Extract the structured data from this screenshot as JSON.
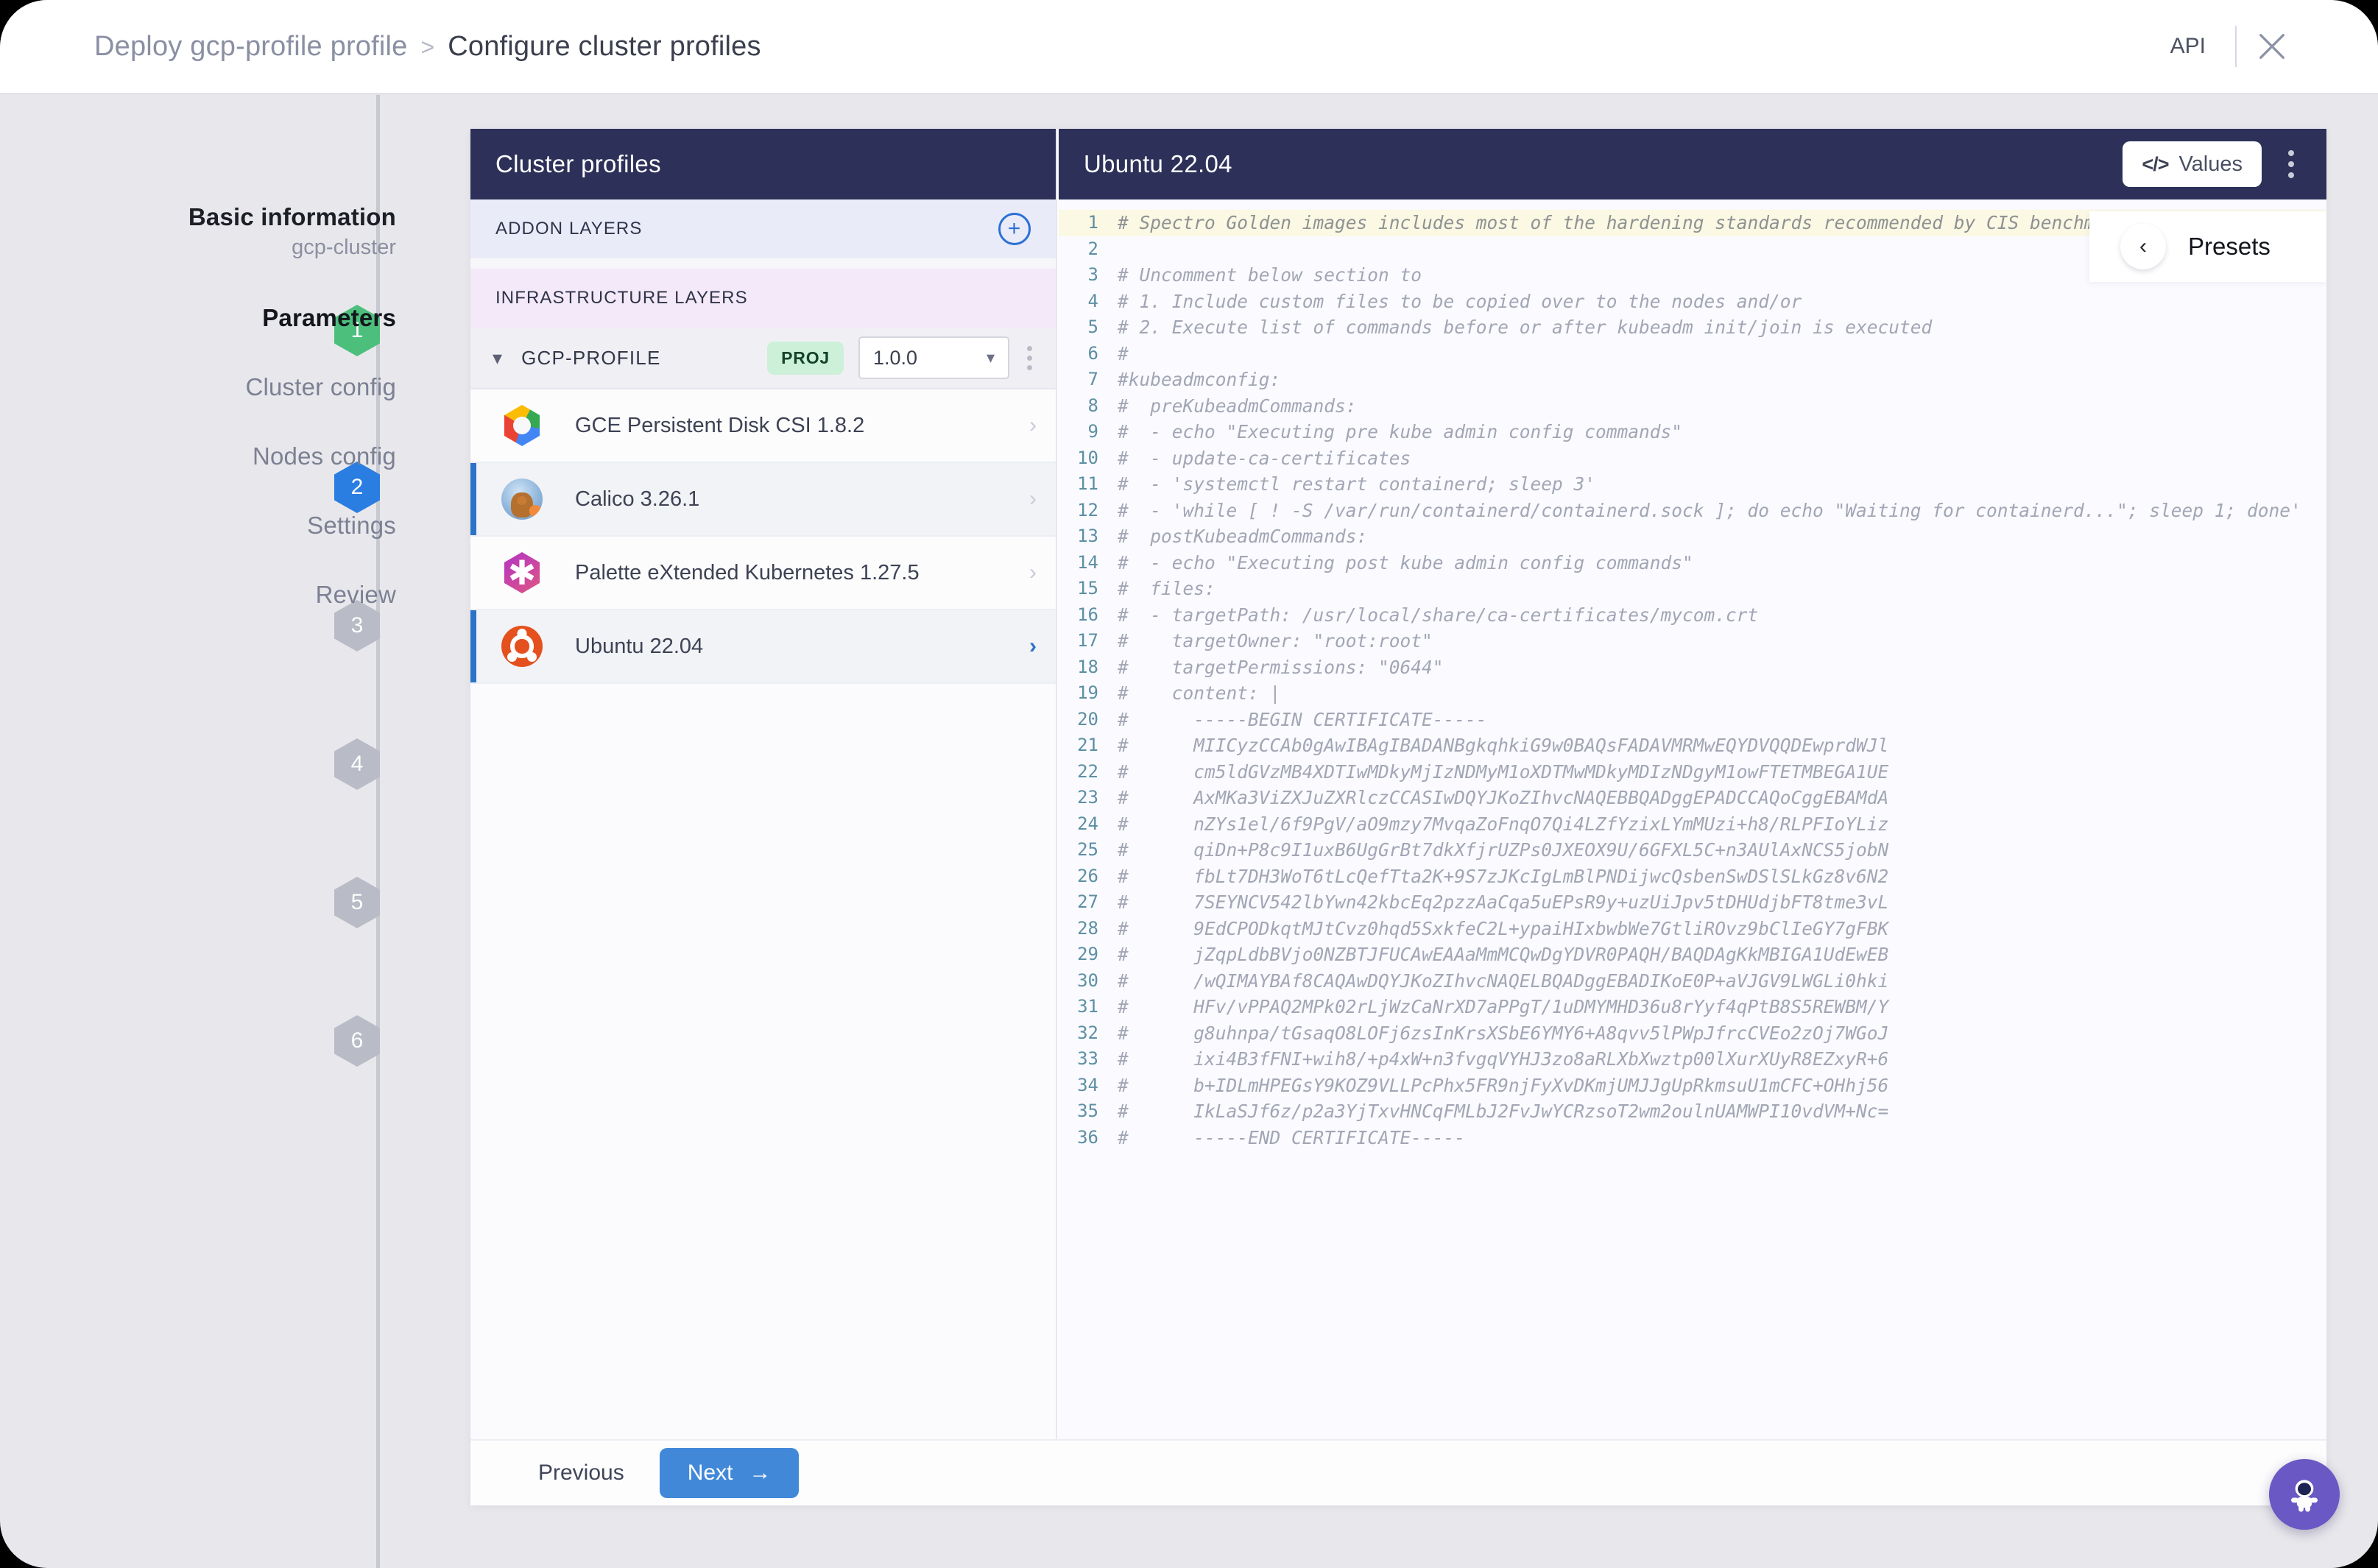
{
  "header": {
    "breadcrumb_parent": "Deploy gcp-profile profile",
    "breadcrumb_separator": ">",
    "breadcrumb_current": "Configure cluster profiles",
    "api_label": "API",
    "close_icon": "close-icon"
  },
  "stepper": {
    "steps": [
      {
        "title": "Basic information",
        "sub": "gcp-cluster",
        "num": "1",
        "state": "done"
      },
      {
        "title": "Parameters",
        "sub": "",
        "num": "2",
        "state": "active"
      },
      {
        "title": "Cluster config",
        "sub": "",
        "num": "3",
        "state": "todo"
      },
      {
        "title": "Nodes config",
        "sub": "",
        "num": "4",
        "state": "todo"
      },
      {
        "title": "Settings",
        "sub": "",
        "num": "5",
        "state": "todo"
      },
      {
        "title": "Review",
        "sub": "",
        "num": "6",
        "state": "todo"
      }
    ]
  },
  "profiles_pane": {
    "title": "Cluster profiles",
    "addon_layers_label": "ADDON LAYERS",
    "add_layer_icon": "plus-circle-icon",
    "infrastructure_layers_label": "INFRASTRUCTURE LAYERS",
    "profile": {
      "name": "GCP-PROFILE",
      "scope_badge": "PROJ",
      "version": "1.0.0",
      "collapse_icon": "chevron-down-icon",
      "menu_icon": "kebab-menu-icon"
    },
    "layers": [
      {
        "name": "GCE Persistent Disk CSI 1.8.2",
        "icon": "gce-icon",
        "selected": false,
        "current": false
      },
      {
        "name": "Calico 3.26.1",
        "icon": "calico-icon",
        "selected": true,
        "current": false
      },
      {
        "name": "Palette eXtended Kubernetes 1.27.5",
        "icon": "palette-kubernetes-icon",
        "selected": false,
        "current": false
      },
      {
        "name": "Ubuntu 22.04",
        "icon": "ubuntu-icon",
        "selected": true,
        "current": true
      }
    ]
  },
  "editor_pane": {
    "title": "Ubuntu 22.04",
    "values_button": "Values",
    "values_icon": "code-brackets-icon",
    "menu_icon": "kebab-menu-icon",
    "presets_label": "Presets",
    "presets_back_icon": "chevron-left-icon",
    "highlighted_line": 1,
    "lines": [
      "# Spectro Golden images includes most of the hardening standards recommended by CIS benchmark",
      "",
      "# Uncomment below section to",
      "# 1. Include custom files to be copied over to the nodes and/or",
      "# 2. Execute list of commands before or after kubeadm init/join is executed",
      "#",
      "#kubeadmconfig:",
      "#  preKubeadmCommands:",
      "#  - echo \"Executing pre kube admin config commands\"",
      "#  - update-ca-certificates",
      "#  - 'systemctl restart containerd; sleep 3'",
      "#  - 'while [ ! -S /var/run/containerd/containerd.sock ]; do echo \"Waiting for containerd...\"; sleep 1; done'",
      "#  postKubeadmCommands:",
      "#  - echo \"Executing post kube admin config commands\"",
      "#  files:",
      "#  - targetPath: /usr/local/share/ca-certificates/mycom.crt",
      "#    targetOwner: \"root:root\"",
      "#    targetPermissions: \"0644\"",
      "#    content: |",
      "#      -----BEGIN CERTIFICATE-----",
      "#      MIICyzCCAb0gAwIBAgIBADANBgkqhkiG9w0BAQsFADAVMRMwEQYDVQQDEwprdWJl",
      "#      cm5ldGVzMB4XDTIwMDkyMjIzNDMyM1oXDTMwMDkyMDIzNDgyM1owFTETMBEGA1UE",
      "#      AxMKa3ViZXJuZXRlczCCASIwDQYJKoZIhvcNAQEBBQADggEPADCCAQoCggEBAMdA",
      "#      nZYs1el/6f9PgV/aO9mzy7MvqaZoFnqO7Qi4LZfYzixLYmMUzi+h8/RLPFIoYLiz",
      "#      qiDn+P8c9I1uxB6UgGrBt7dkXfjrUZPs0JXEOX9U/6GFXL5C+n3AUlAxNCS5jobN",
      "#      fbLt7DH3WoT6tLcQefTta2K+9S7zJKcIgLmBlPNDijwcQsbenSwDSlSLkGz8v6N2",
      "#      7SEYNCV542lbYwn42kbcEq2pzzAaCqa5uEPsR9y+uzUiJpv5tDHUdjbFT8tme3vL",
      "#      9EdCPODkqtMJtCvz0hqd5SxkfeC2L+ypaiHIxbwbWe7GtliROvz9bClIeGY7gFBK",
      "#      jZqpLdbBVjo0NZBTJFUCAwEAAaMmMCQwDgYDVR0PAQH/BAQDAgKkMBIGA1UdEwEB",
      "#      /wQIMAYBAf8CAQAwDQYJKoZIhvcNAQELBQADggEBADIKoE0P+aVJGV9LWGLi0hki",
      "#      HFv/vPPAQ2MPk02rLjWzCaNrXD7aPPgT/1uDMYMHD36u8rYyf4qPtB8S5REWBM/Y",
      "#      g8uhnpa/tGsaqO8LOFj6zsInKrsXSbE6YMY6+A8qvv5lPWpJfrcCVEo2zOj7WGoJ",
      "#      ixi4B3fFNI+wih8/+p4xW+n3fvgqVYHJ3zo8aRLXbXwztp00lXurXUyR8EZxyR+6",
      "#      b+IDLmHPEGsY9KOZ9VLLPcPhx5FR9njFyXvDKmjUMJJgUpRkmsuU1mCFC+OHhj56",
      "#      IkLaSJf6z/p2a3YjTxvHNCqFMLbJ2FvJwYCRzsoT2wm2oulnUAMWPI10vdVM+Nc=",
      "#      -----END CERTIFICATE-----"
    ]
  },
  "footer": {
    "previous_label": "Previous",
    "next_label": "Next",
    "next_icon": "arrow-right-icon"
  },
  "fab": {
    "icon": "astronaut-icon"
  }
}
